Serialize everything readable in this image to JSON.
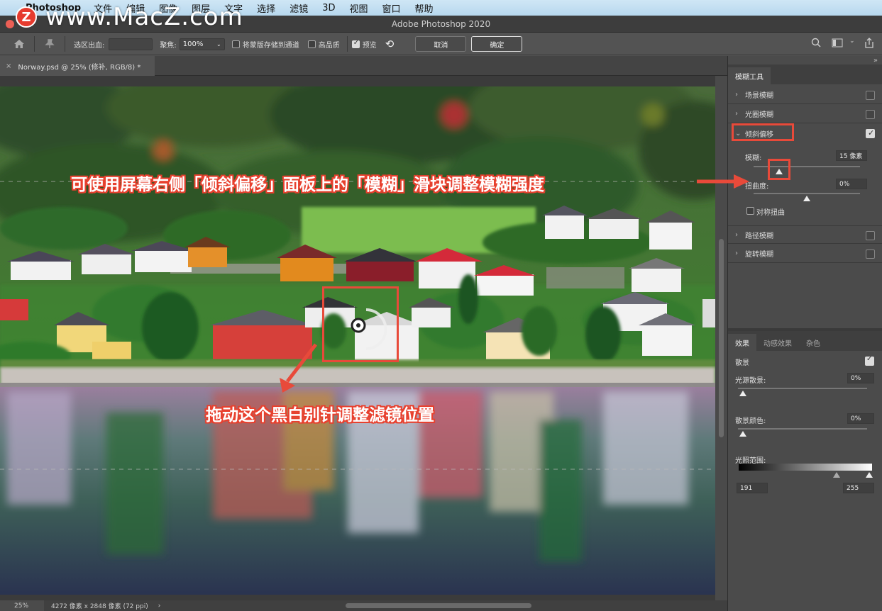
{
  "menubar": {
    "app_name": "Photoshop",
    "items": [
      "文件",
      "编辑",
      "图像",
      "图层",
      "文字",
      "选择",
      "滤镜",
      "3D",
      "视图",
      "窗口",
      "帮助"
    ]
  },
  "watermark": {
    "badge": "Z",
    "text": "www.MacZ.com"
  },
  "window": {
    "title": "Adobe Photoshop 2020"
  },
  "options": {
    "selection_bleed_label": "选区出血:",
    "selection_bleed_value": "",
    "focus_label": "聚焦:",
    "focus_value": "100%",
    "save_mask_label": "将蒙版存储到通道",
    "high_quality_label": "高品质",
    "preview_label": "预览",
    "cancel_label": "取消",
    "ok_label": "确定"
  },
  "document": {
    "tab_title": "Norway.psd @ 25% (修补, RGB/8) *"
  },
  "status": {
    "zoom": "25%",
    "doc_info": "4272 像素 x 2848 像素 (72 ppi)",
    "arrow": "›"
  },
  "blur_panel": {
    "tab": "模糊工具",
    "items": [
      {
        "label": "场景模糊",
        "checked": false
      },
      {
        "label": "光圈模糊",
        "checked": false
      },
      {
        "label": "倾斜偏移",
        "checked": true
      },
      {
        "label": "路径模糊",
        "checked": false
      },
      {
        "label": "旋转模糊",
        "checked": false
      }
    ],
    "blur_label": "模糊:",
    "blur_value": "15 像素",
    "distortion_label": "扭曲度:",
    "distortion_value": "0%",
    "symmetric_label": "对称扭曲"
  },
  "effects_panel": {
    "tabs": [
      "效果",
      "动感效果",
      "杂色"
    ],
    "bokeh_label": "散景",
    "light_bokeh_label": "光源散景:",
    "light_bokeh_value": "0%",
    "bokeh_color_label": "散景颜色:",
    "bokeh_color_value": "0%",
    "light_range_label": "光照范围:",
    "light_range_low": "191",
    "light_range_high": "255"
  },
  "annotations": {
    "blur_slider_note": "可使用屏幕右侧「倾斜偏移」面板上的「模糊」滑块调整模糊强度",
    "pin_note": "拖动这个黑白别针调整滤镜位置"
  },
  "colors": {
    "annotation_red": "#e84a3a",
    "panel_bg": "#4b4b4b",
    "ui_bg": "#535353"
  }
}
